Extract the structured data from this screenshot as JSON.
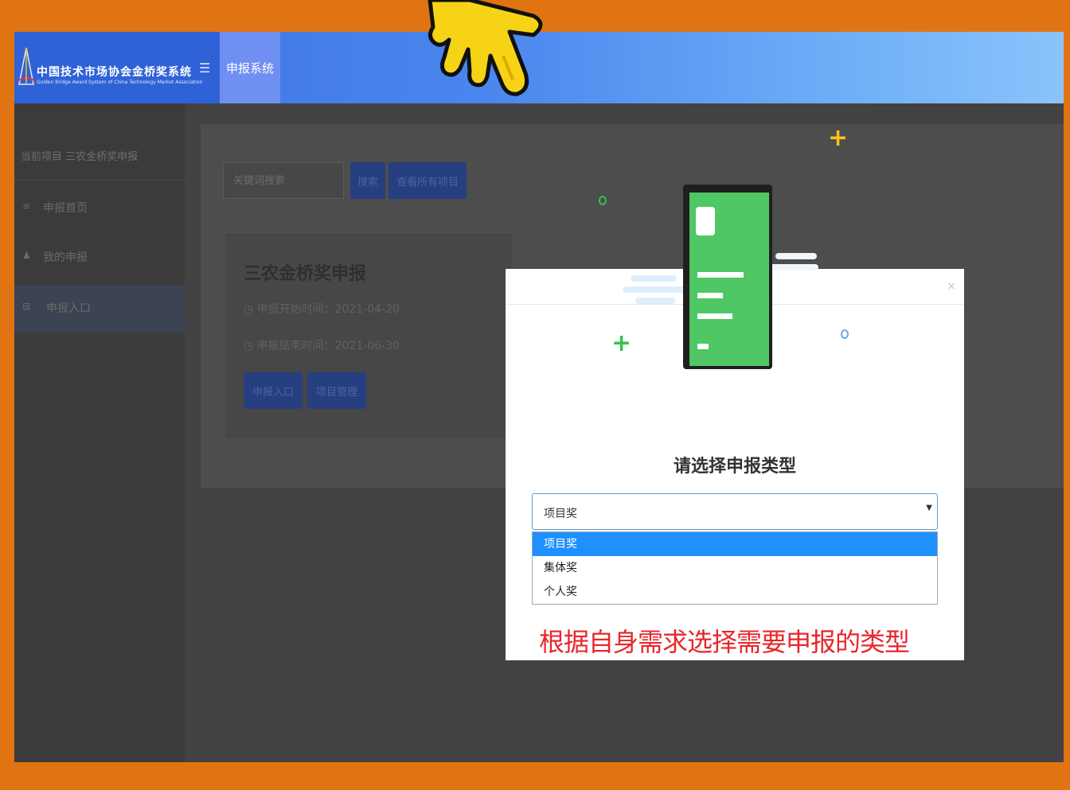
{
  "app": {
    "title": "中国技术市场协会金桥奖系统",
    "subtitle": "Golden Bridge Award System of China Technology Market Association",
    "menu_icon": "☰",
    "nav_tab": "申报系统"
  },
  "sidebar": {
    "breadcrumb": "当前项目 三农金桥奖申报",
    "items": [
      {
        "icon": "≡",
        "label": "申报首页"
      },
      {
        "icon": "♟",
        "label": "我的申报"
      },
      {
        "icon": "⊟",
        "label": "申报入口"
      }
    ]
  },
  "toolbar": {
    "search_placeholder": "关键词搜索",
    "search_button": "搜索",
    "second_button": "查看所有项目"
  },
  "card": {
    "title": "三农金桥奖申报",
    "start": "申报开始时间：2021-04-20",
    "end": "申报结束时间：2021-06-30",
    "button1": "申报入口",
    "button2": "项目管理"
  },
  "modal": {
    "close": "×",
    "prompt": "请选择申报类型",
    "select_value": "项目奖",
    "options": [
      "项目奖",
      "集体奖",
      "个人奖"
    ],
    "selected_index": 0,
    "hint": "根据自身需求选择需要申报的类型"
  },
  "colors": {
    "frame": "#e07412",
    "accent_blue": "#1e90ff",
    "hint_red": "#e8262b",
    "phone_green": "#3cc35a"
  }
}
